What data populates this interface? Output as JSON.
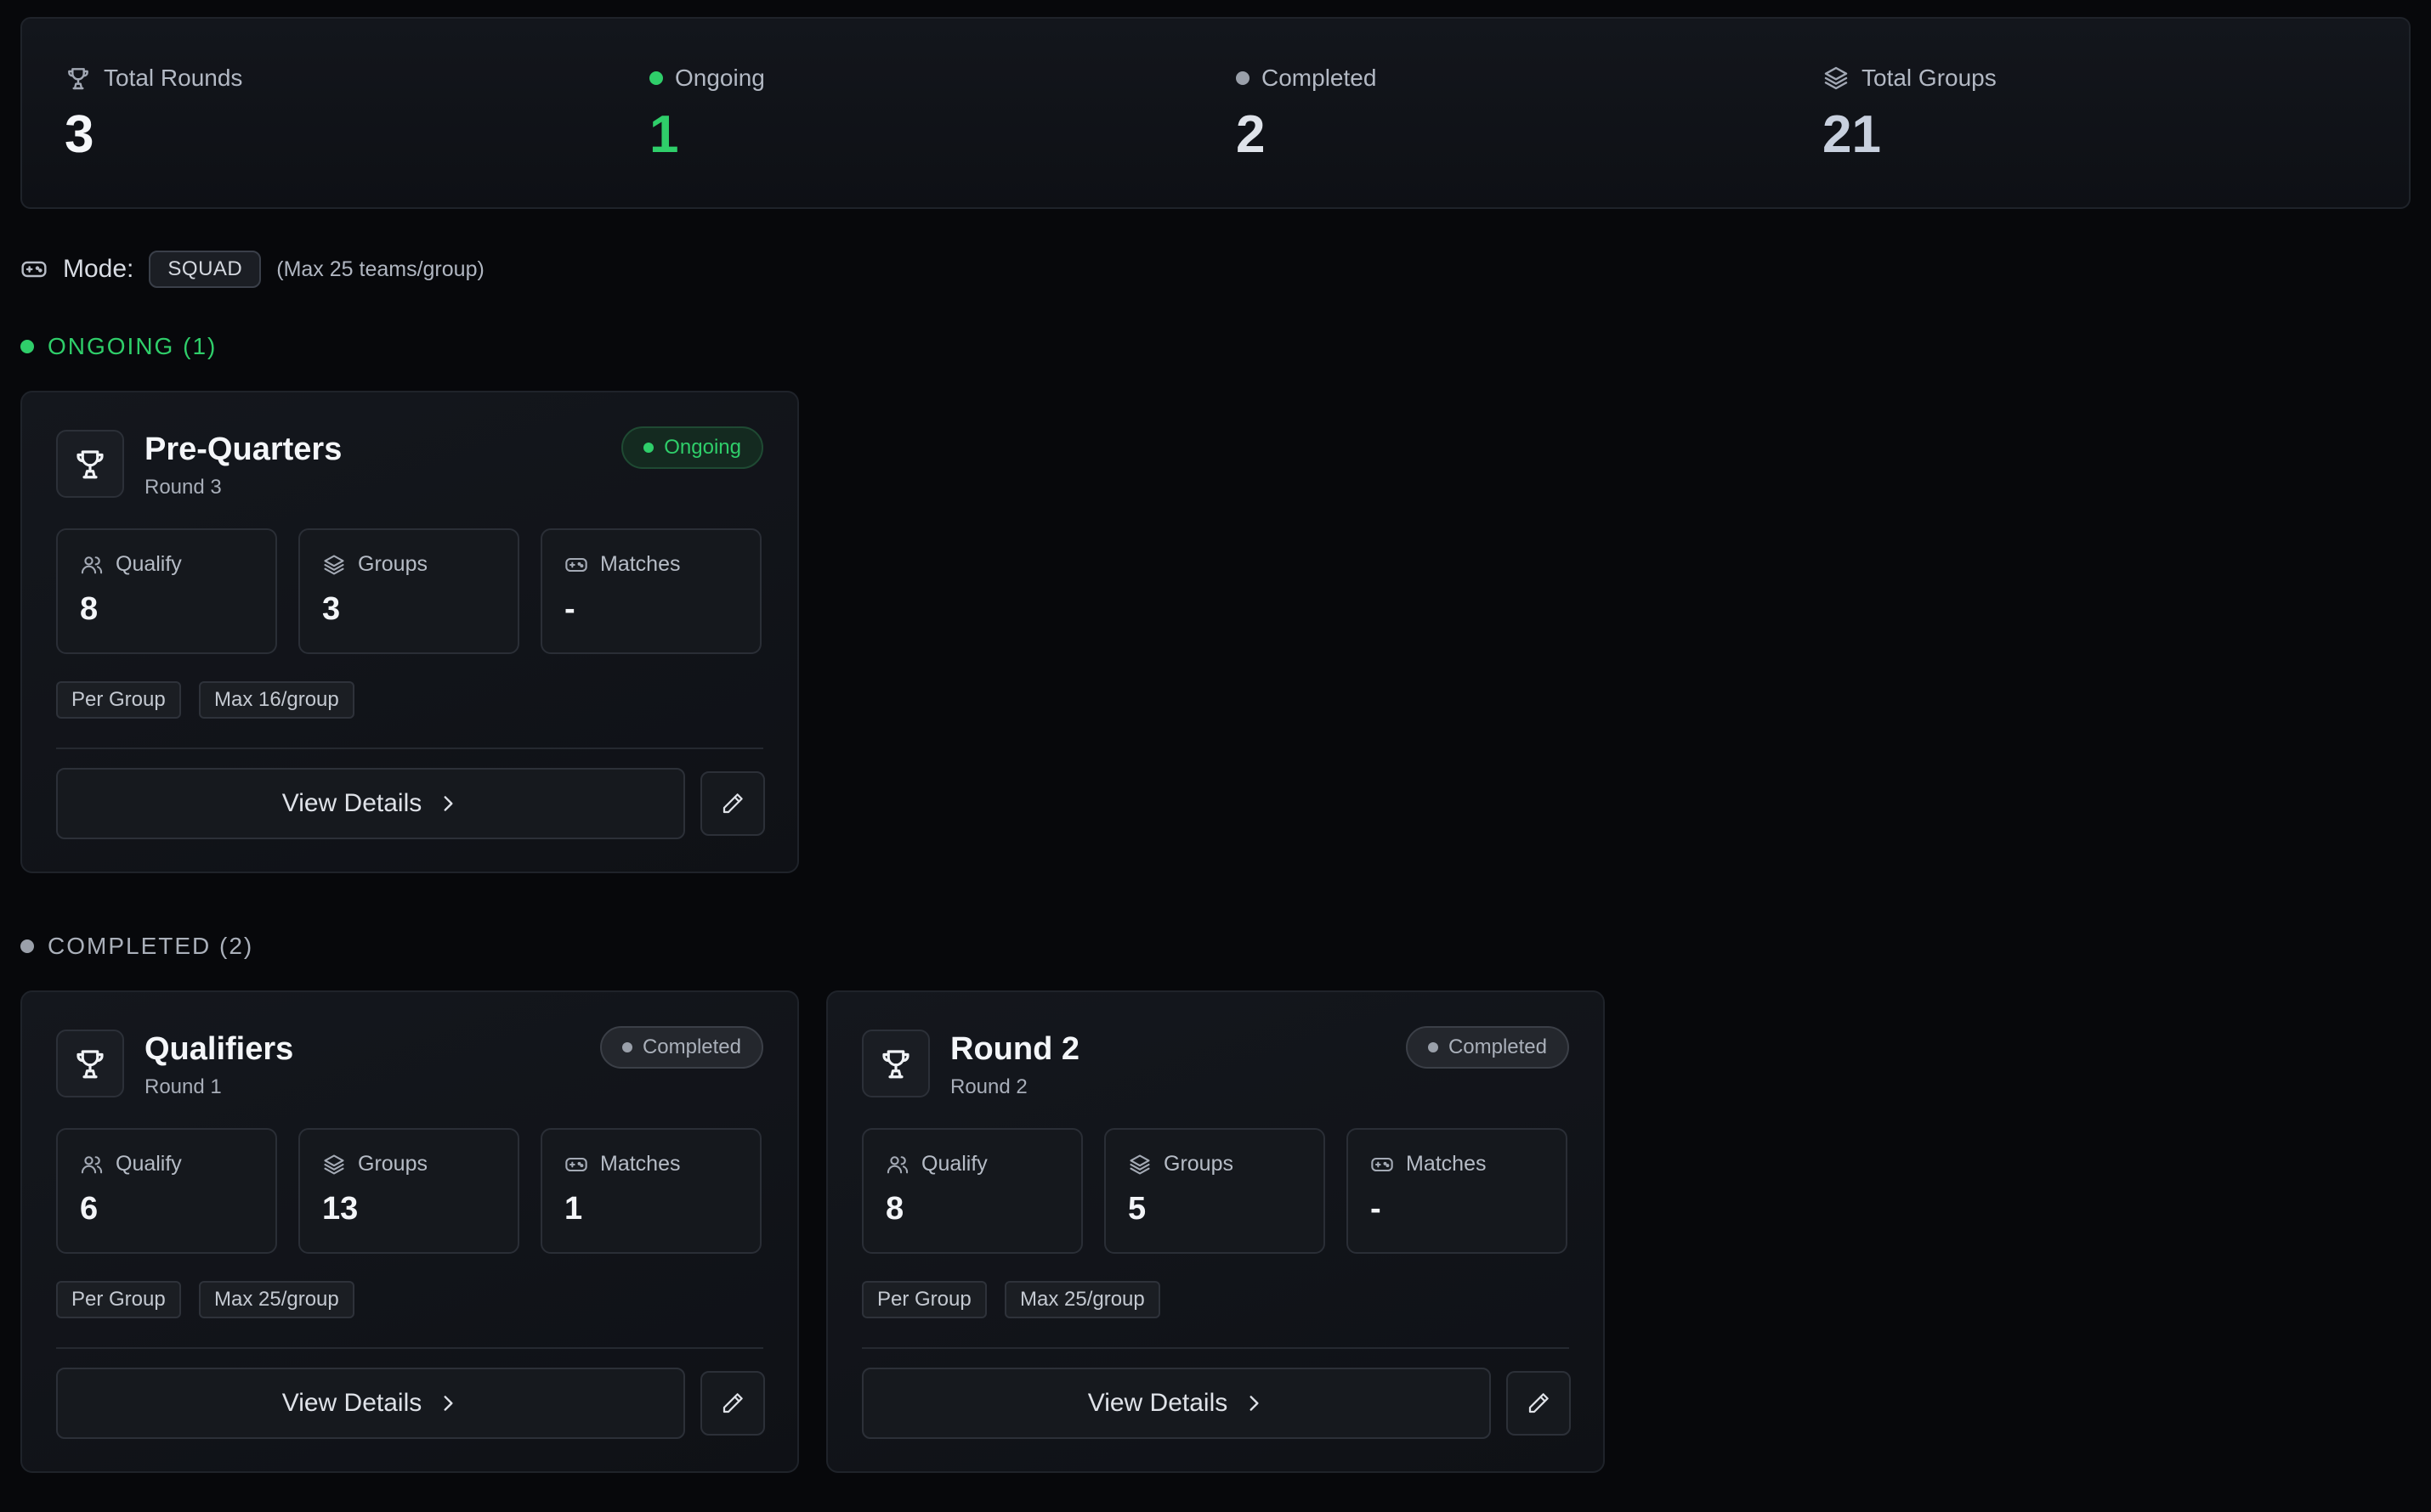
{
  "stats": [
    {
      "label": "Total Rounds",
      "value": "3",
      "icon": "trophy-icon",
      "color": "#f5f7fa"
    },
    {
      "label": "Ongoing",
      "value": "1",
      "icon": "green-dot",
      "color": "#2fce6a"
    },
    {
      "label": "Completed",
      "value": "2",
      "icon": "gray-dot",
      "color": "#dfe3ea"
    },
    {
      "label": "Total Groups",
      "value": "21",
      "icon": "layers-icon",
      "color": "#c8d0de"
    }
  ],
  "mode": {
    "label": "Mode:",
    "value": "SQUAD",
    "note": "(Max 25 teams/group)"
  },
  "sections": {
    "ongoing": {
      "label": "ONGOING (1)",
      "color": "#2fce6a"
    },
    "completed": {
      "label": "COMPLETED (2)",
      "color": "#9aa0aa"
    }
  },
  "metric_labels": {
    "qualify": "Qualify",
    "groups": "Groups",
    "matches": "Matches"
  },
  "view_details_label": "View Details",
  "cards": [
    {
      "title": "Pre-Quarters",
      "subtitle": "Round 3",
      "status": "Ongoing",
      "qualify": "8",
      "groups": "3",
      "matches": "-",
      "tag1": "Per Group",
      "tag2": "Max 16/group"
    },
    {
      "title": "Qualifiers",
      "subtitle": "Round 1",
      "status": "Completed",
      "qualify": "6",
      "groups": "13",
      "matches": "1",
      "tag1": "Per Group",
      "tag2": "Max 25/group"
    },
    {
      "title": "Round 2",
      "subtitle": "Round 2",
      "status": "Completed",
      "qualify": "8",
      "groups": "5",
      "matches": "-",
      "tag1": "Per Group",
      "tag2": "Max 25/group"
    }
  ]
}
